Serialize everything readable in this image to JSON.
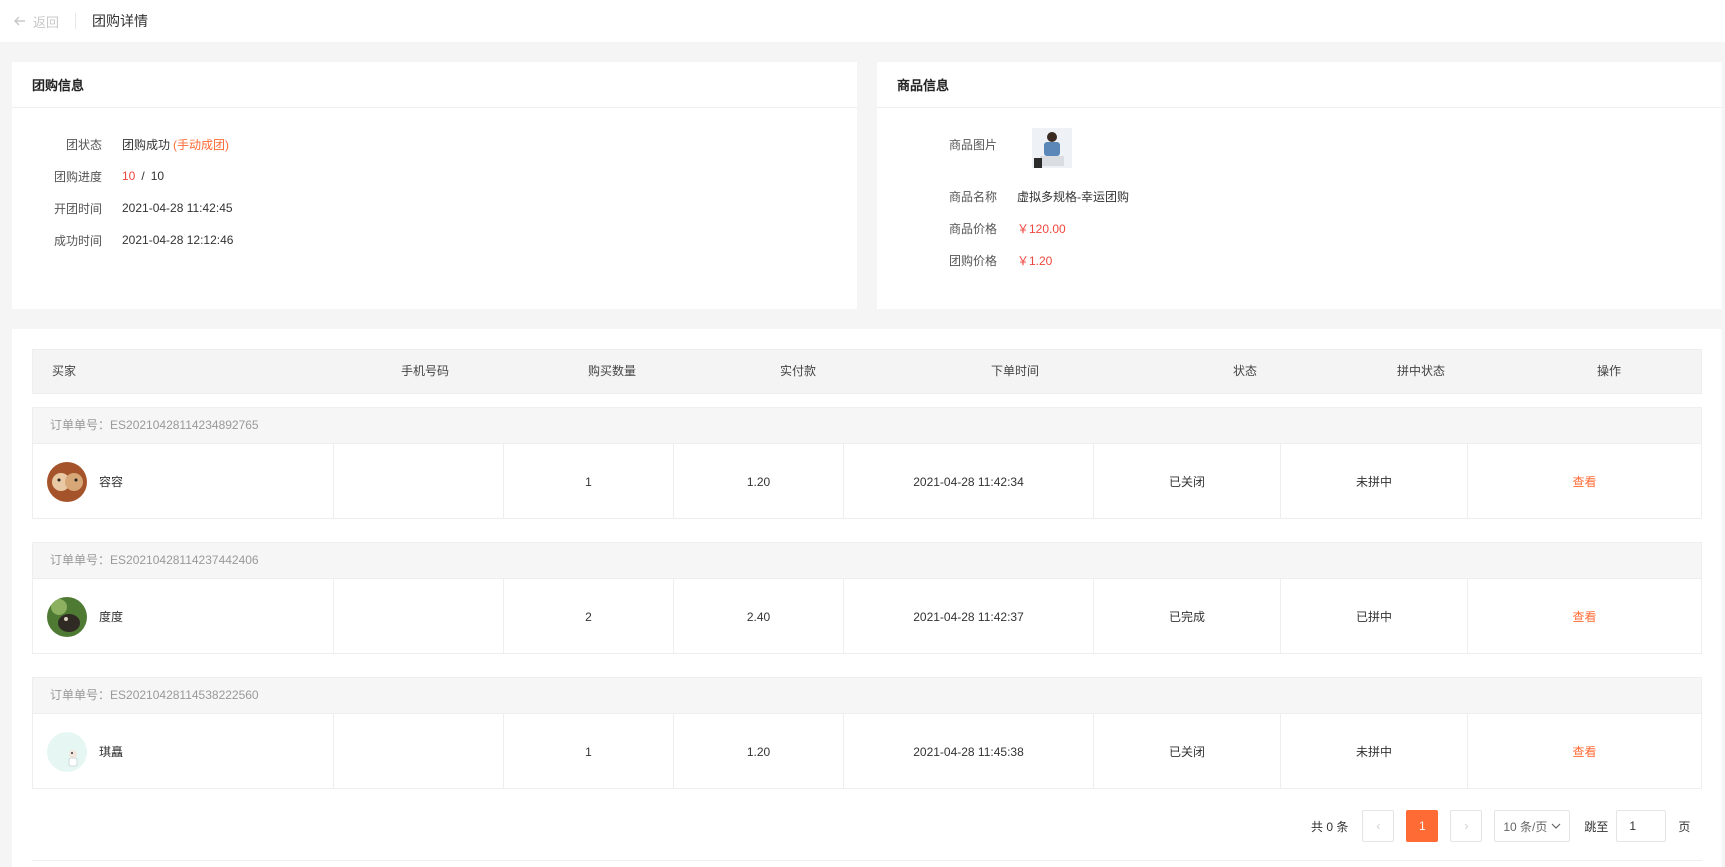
{
  "header": {
    "back_label": "返回",
    "title": "团购详情"
  },
  "group_info": {
    "title": "团购信息",
    "status_label": "团状态",
    "status_value": "团购成功",
    "status_note": "(手动成团)",
    "progress_label": "团购进度",
    "progress_current": "10",
    "progress_sep": "/",
    "progress_total": "10",
    "open_time_label": "开团时间",
    "open_time": "2021-04-28 11:42:45",
    "success_time_label": "成功时间",
    "success_time": "2021-04-28 12:12:46"
  },
  "product_info": {
    "title": "商品信息",
    "image_label": "商品图片",
    "name_label": "商品名称",
    "name": "虚拟多规格-幸运团购",
    "price_label": "商品价格",
    "price": "￥120.00",
    "group_price_label": "团购价格",
    "group_price": "￥1.20"
  },
  "table": {
    "columns": [
      "买家",
      "手机号码",
      "购买数量",
      "实付款",
      "下单时间",
      "状态",
      "拼中状态",
      "操作"
    ],
    "order_prefix": "订单单号：",
    "rows": [
      {
        "order_no": "ES2021042811423489276​5",
        "buyer": "容容",
        "phone": "",
        "qty": "1",
        "paid": "1.20",
        "time": "2021-04-28 11:42:34",
        "status": "已关闭",
        "win": "未拼中",
        "action": "查看"
      },
      {
        "order_no": "ES20210428114237442406",
        "buyer": "度度",
        "phone": "",
        "qty": "2",
        "paid": "2.40",
        "time": "2021-04-28 11:42:37",
        "status": "已完成",
        "win": "已拼中",
        "action": "查看"
      },
      {
        "order_no": "ES20210428114538222560",
        "buyer": "琪矗",
        "phone": "",
        "qty": "1",
        "paid": "1.20",
        "time": "2021-04-28 11:45:38",
        "status": "已关闭",
        "win": "未拼中",
        "action": "查看"
      }
    ]
  },
  "pagination": {
    "total_text": "共 0 条",
    "current_page": "1",
    "page_size": "10 条/页",
    "jump_label": "跳至",
    "jump_value": "1",
    "page_unit": "页"
  },
  "colors": {
    "accent": "#ff6b35",
    "price_red": "#f0473d"
  }
}
